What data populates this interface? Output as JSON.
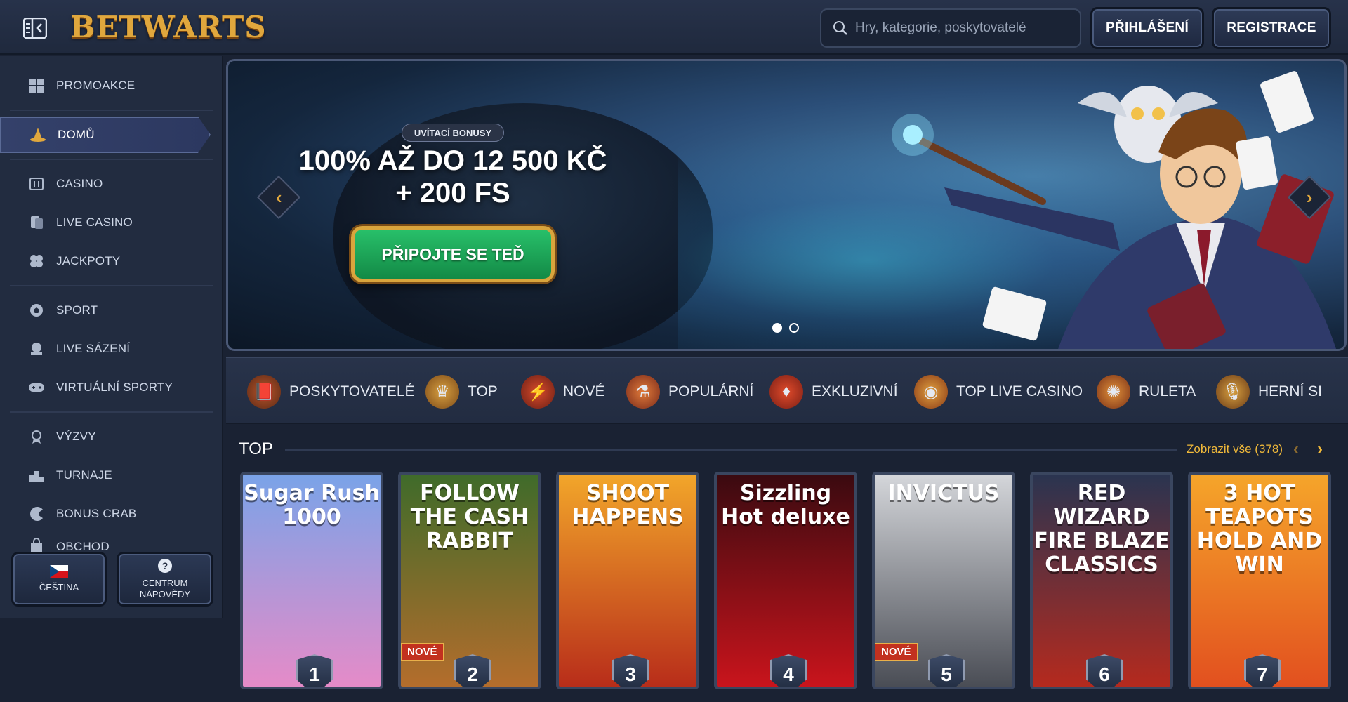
{
  "header": {
    "logo_text": "BETWARTS",
    "search_placeholder": "Hry, kategorie, poskytovatelé",
    "login_label": "PŘIHLÁŠENÍ",
    "register_label": "REGISTRACE"
  },
  "sidebar": {
    "items": [
      {
        "label": "PROMOAKCE",
        "icon": "promo-grid-icon"
      },
      {
        "label": "DOMŮ",
        "icon": "wizard-hat-icon"
      },
      {
        "label": "CASINO",
        "icon": "slot-machine-icon"
      },
      {
        "label": "LIVE CASINO",
        "icon": "live-cards-icon"
      },
      {
        "label": "JACKPOTY",
        "icon": "clover-icon"
      },
      {
        "label": "SPORT",
        "icon": "football-icon"
      },
      {
        "label": "LIVE SÁZENÍ",
        "icon": "live-bet-icon"
      },
      {
        "label": "VIRTUÁLNÍ SPORTY",
        "icon": "gamepad-icon"
      },
      {
        "label": "VÝZVY",
        "icon": "medal-icon"
      },
      {
        "label": "TURNAJE",
        "icon": "podium-icon"
      },
      {
        "label": "BONUS CRAB",
        "icon": "crab-icon"
      },
      {
        "label": "OBCHOD",
        "icon": "shop-icon"
      }
    ],
    "language_label": "ČEŠTINA",
    "help_label_1": "CENTRUM",
    "help_label_2": "NÁPOVĚDY"
  },
  "hero": {
    "badge": "UVÍTACÍ BONUSY",
    "title_line1": "100% AŽ DO 12 500 KČ",
    "title_line2": "+ 200 FS",
    "cta": "PŘIPOJTE SE TEĎ",
    "slides": 2,
    "active_slide": 1
  },
  "categories": [
    {
      "label": "POSKYTOVATELÉ",
      "icon": "book-icon"
    },
    {
      "label": "TOP",
      "icon": "crown-icon"
    },
    {
      "label": "NOVÉ",
      "icon": "lightning-icon"
    },
    {
      "label": "POPULÁRNÍ",
      "icon": "potion-icon"
    },
    {
      "label": "EXKLUZIVNÍ",
      "icon": "gem-icon"
    },
    {
      "label": "TOP LIVE CASINO",
      "icon": "chip-icon"
    },
    {
      "label": "RULETA",
      "icon": "roulette-icon"
    },
    {
      "label": "HERNÍ SI",
      "icon": "microphone-icon"
    }
  ],
  "top_section": {
    "title": "TOP",
    "show_all": "Zobrazit vše (378)",
    "games": [
      {
        "title": "Sugar Rush 1000",
        "rank": "1",
        "badge": "",
        "bg1": "#7aa3e8",
        "bg2": "#e58bc8"
      },
      {
        "title": "FOLLOW THE CASH RABBIT",
        "rank": "2",
        "badge": "NOVÉ",
        "bg1": "#3f6b2a",
        "bg2": "#b46d2c"
      },
      {
        "title": "SHOOT HAPPENS",
        "rank": "3",
        "badge": "",
        "bg1": "#f2a62a",
        "bg2": "#b82d1a"
      },
      {
        "title": "Sizzling Hot deluxe",
        "rank": "4",
        "badge": "",
        "bg1": "#3a0a10",
        "bg2": "#c9141c"
      },
      {
        "title": "INVICTUS",
        "rank": "5",
        "badge": "NOVÉ",
        "bg1": "#d4d6da",
        "bg2": "#4a4d55"
      },
      {
        "title": "RED WIZARD FIRE BLAZE CLASSICS",
        "rank": "6",
        "badge": "",
        "bg1": "#2a3450",
        "bg2": "#b52a1e"
      },
      {
        "title": "3 HOT TEAPOTS HOLD AND WIN",
        "rank": "7",
        "badge": "",
        "bg1": "#f5a52a",
        "bg2": "#e2501f"
      }
    ]
  }
}
